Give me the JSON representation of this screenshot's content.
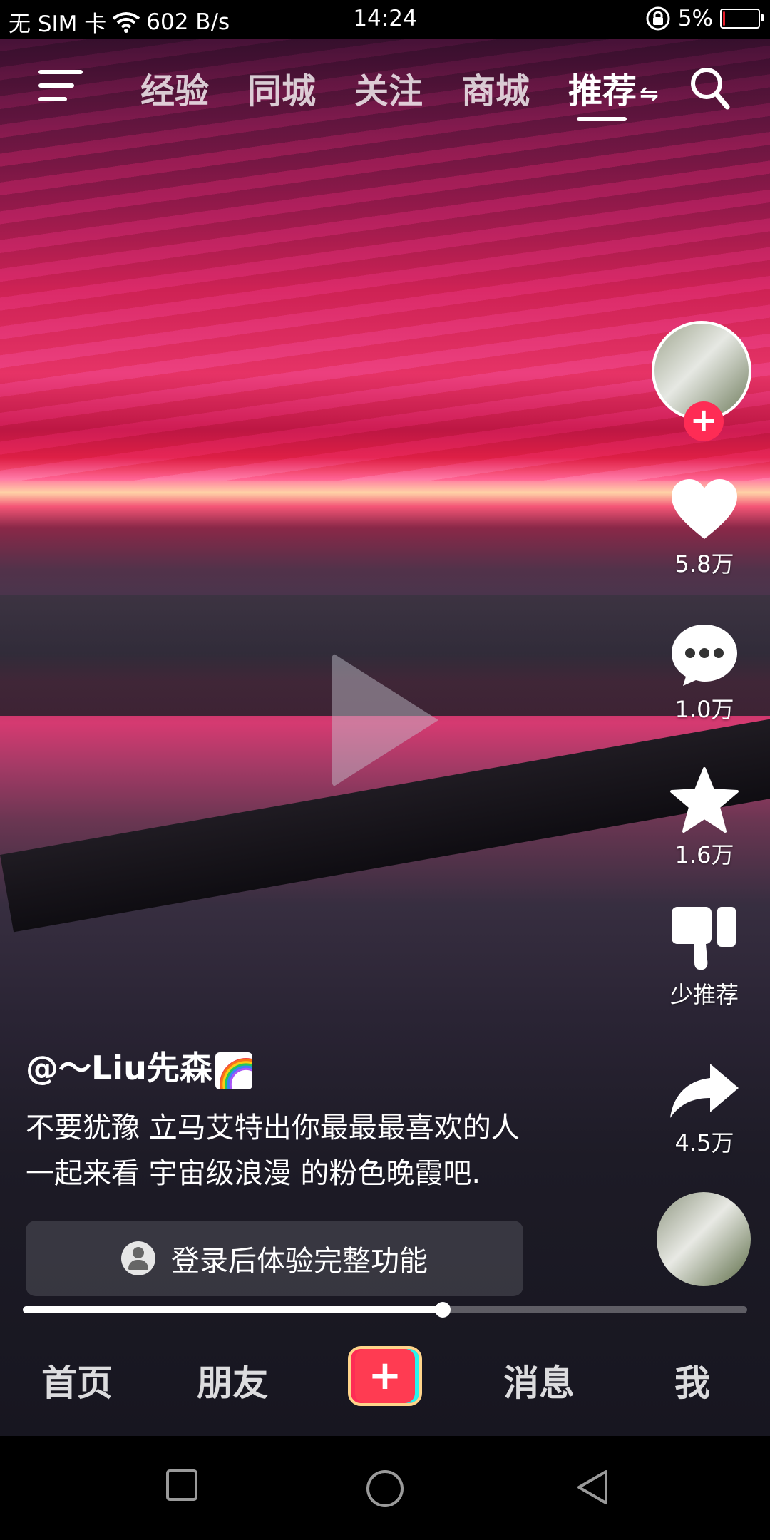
{
  "status_bar": {
    "carrier": "无 SIM 卡",
    "network_speed": "602 B/s",
    "time": "14:24",
    "battery_percent": "5%",
    "battery_level": 0.05,
    "battery_color": "#e61e2c"
  },
  "top_nav": {
    "menu_icon": "hamburger-menu-icon",
    "tabs": [
      {
        "label": "经验"
      },
      {
        "label": "同城"
      },
      {
        "label": "关注"
      },
      {
        "label": "商城"
      },
      {
        "label": "推荐"
      }
    ],
    "active_tab": "推荐",
    "search_icon": "search-icon"
  },
  "video": {
    "play_icon": "play-icon"
  },
  "right_rail": {
    "like_count": "5.8万",
    "comment_count": "1.0万",
    "favorite_count": "1.6万",
    "dislike_label": "少推荐",
    "share_count": "4.5万",
    "follow_plus": "+"
  },
  "post": {
    "username": "@～Liu先森",
    "caption_line1": "不要犹豫 立马艾特出你最最最喜欢的人",
    "caption_line2": "一起来看 宇宙级浪漫 的粉色晚霞吧."
  },
  "login_prompt": {
    "text": "登录后体验完整功能"
  },
  "progress": {
    "value": 0.58
  },
  "bottom_tabs": {
    "home": "首页",
    "friends": "朋友",
    "create": "+",
    "messages": "消息",
    "me": "我"
  },
  "colors": {
    "accent": "#fe2c55",
    "create_button": "#ff3b52",
    "create_border": "#ffd48a"
  }
}
